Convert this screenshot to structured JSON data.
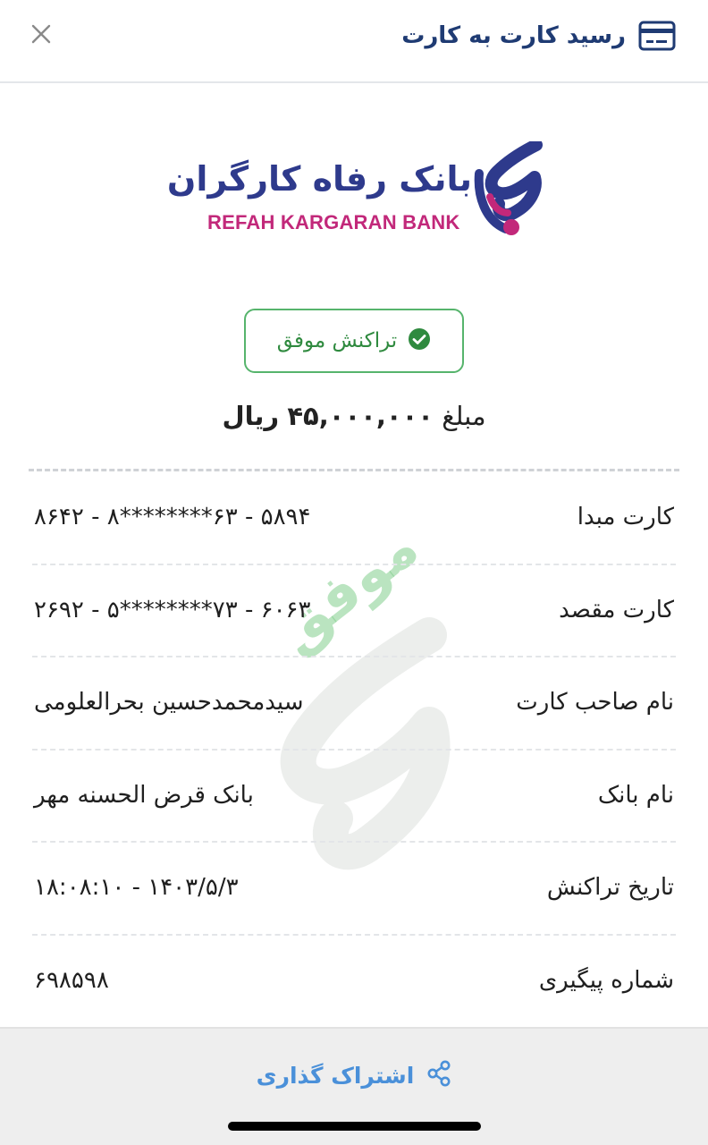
{
  "header": {
    "title": "رسید کارت به کارت",
    "card_icon": "credit-card-icon",
    "close_icon": "close-icon"
  },
  "logo": {
    "fa_text": "بانک رفاه کارگران",
    "en_text": "REFAH KARGARAN BANK",
    "colors": {
      "primary": "#2e3a8c",
      "accent": "#c2287a"
    }
  },
  "status": {
    "text": "تراکنش موفق",
    "icon": "check-circle-icon",
    "color": "#2f8a3f"
  },
  "amount": {
    "prefix": "مبلغ",
    "value": "۴۵,۰۰۰,۰۰۰",
    "currency": "ریال"
  },
  "watermark": {
    "text": "موفق"
  },
  "details": [
    {
      "label": "کارت مبدا",
      "value": "۵۸۹۴ - ۶۳********۸ - ۸۶۴۲"
    },
    {
      "label": "کارت مقصد",
      "value": "۶۰۶۳ - ۷۳********۵ - ۲۶۹۲"
    },
    {
      "label": "نام صاحب کارت",
      "value": "سیدمحمدحسین بحرالعلومی"
    },
    {
      "label": "نام بانک",
      "value": "بانک قرض الحسنه مهر"
    },
    {
      "label": "تاریخ تراکنش",
      "value": "۱۴۰۳/۵/۳ - ۱۸:۰۸:۱۰"
    },
    {
      "label": "شماره پیگیری",
      "value": "۶۹۸۵۹۸"
    }
  ],
  "footer": {
    "share_label": "اشتراک گذاری",
    "share_icon": "share-icon",
    "accent": "#4a90d9"
  }
}
